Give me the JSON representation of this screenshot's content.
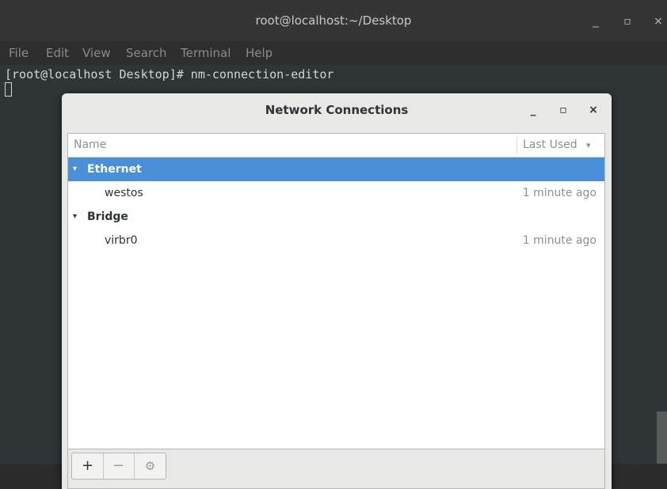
{
  "terminal": {
    "title": "root@localhost:~/Desktop",
    "controls": {
      "minimize": "_",
      "maximize": "▫",
      "close": "×"
    },
    "menu": [
      "File",
      "Edit",
      "View",
      "Search",
      "Terminal",
      "Help"
    ],
    "prompt_line": "[root@localhost Desktop]# nm-connection-editor"
  },
  "dialog": {
    "title": "Network Connections",
    "controls": {
      "minimize": "_",
      "maximize": "▫",
      "close": "×"
    },
    "columns": {
      "name": "Name",
      "last_used": "Last Used",
      "sort_icon": "▾"
    },
    "groups": [
      {
        "label": "Ethernet",
        "expander": "▾",
        "selected": true,
        "items": [
          {
            "name": "westos",
            "last_used": "1 minute ago"
          }
        ]
      },
      {
        "label": "Bridge",
        "expander": "▾",
        "selected": false,
        "items": [
          {
            "name": "virbr0",
            "last_used": "1 minute ago"
          }
        ]
      }
    ],
    "toolbar": {
      "add": "+",
      "remove": "−",
      "settings": "⚙"
    }
  }
}
